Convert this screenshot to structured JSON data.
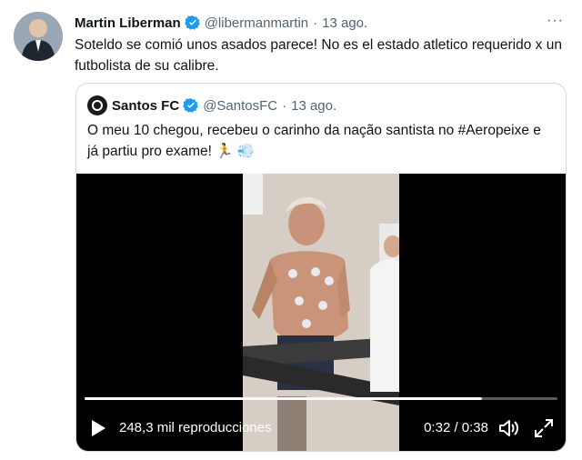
{
  "tweet": {
    "author_name": "Martin Liberman",
    "handle": "@libermanmartin",
    "separator": "·",
    "date": "13 ago.",
    "more": "···",
    "text": "Soteldo se comió unos asados parece! No es el estado atletico requerido x un futbolista de su calibre."
  },
  "quote": {
    "author_name": "Santos FC",
    "handle": "@SantosFC",
    "separator": "·",
    "date": "13 ago.",
    "text": "O meu 10 chegou, recebeu o carinho da nação santista no #Aeropeixe e já partiu pro exame! 🏃 💨"
  },
  "video": {
    "views": "248,3 mil reproducciones",
    "time": "0:32 / 0:38",
    "progress": 0.84
  },
  "colors": {
    "verified": "#1d9bf0",
    "secondary_text": "#536471",
    "border": "#cfd9de"
  },
  "icons": [
    "verified-badge-icon",
    "more-icon",
    "play-icon",
    "volume-icon",
    "fullscreen-icon"
  ]
}
